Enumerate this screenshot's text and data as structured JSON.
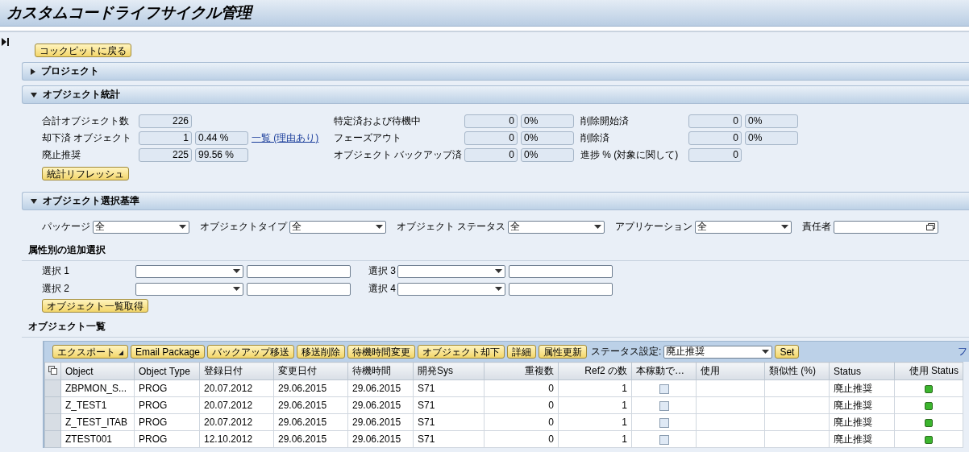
{
  "title": "カスタムコードライフサイクル管理",
  "back_button": "コックピットに戻る",
  "project_panel": {
    "title": "プロジェクト",
    "expanded": false
  },
  "stats_panel": {
    "title": "オブジェクト統計",
    "expanded": true,
    "columns": [
      [
        {
          "label": "合計オブジェクト数",
          "value": "226"
        },
        {
          "label": "却下済 オブジェクト",
          "value": "1",
          "percent": "0.44 %",
          "link": "一覧 (理由あり)"
        },
        {
          "label": "廃止推奨",
          "value": "225",
          "percent": "99.56 %"
        }
      ],
      [
        {
          "label": "特定済および待機中",
          "value": "0",
          "percent": "0%"
        },
        {
          "label": "フェーズアウト",
          "value": "0",
          "percent": "0%"
        },
        {
          "label": "オブジェクト バックアップ済",
          "value": "0",
          "percent": "0%"
        }
      ],
      [
        {
          "label": "削除開始済",
          "value": "0",
          "percent": "0%"
        },
        {
          "label": "削除済",
          "value": "0",
          "percent": "0%"
        },
        {
          "label": "進捗 % (対象に関して)",
          "value": "0"
        }
      ]
    ],
    "refresh_button": "統計リフレッシュ"
  },
  "criteria_panel": {
    "title": "オブジェクト選択基準",
    "expanded": true,
    "filters": [
      {
        "label": "パッケージ",
        "value": "全",
        "kind": "dropdown"
      },
      {
        "label": "オブジェクトタイプ",
        "value": "全",
        "kind": "dropdown"
      },
      {
        "label": "オブジェクト ステータス",
        "value": "全",
        "kind": "dropdown"
      },
      {
        "label": "アプリケーション",
        "value": "全",
        "kind": "dropdown"
      },
      {
        "label": "責任者",
        "kind": "picker"
      }
    ],
    "extra_title": "属性別の追加選択",
    "extra": [
      {
        "label": "選択 1"
      },
      {
        "label": "選択 3"
      },
      {
        "label": "選択 2"
      },
      {
        "label": "選択 4"
      }
    ],
    "fetch_button": "オブジェクト一覧取得"
  },
  "list_title": "オブジェクト一覧",
  "toolbar": {
    "buttons": [
      {
        "label": "エクスポート",
        "kind": "menu"
      },
      {
        "label": "Email Package",
        "kind": "plain"
      },
      {
        "label": "バックアップ移送",
        "kind": "plain"
      },
      {
        "label": "移送削除",
        "kind": "plain"
      },
      {
        "label": "待機時間変更",
        "kind": "plain"
      },
      {
        "label": "オブジェクト却下",
        "kind": "plain"
      },
      {
        "label": "詳細",
        "kind": "plain"
      },
      {
        "label": "属性更新",
        "kind": "plain"
      }
    ],
    "status_label": "ステータス設定:",
    "status_value": "廃止推奨",
    "set_button": "Set",
    "link": "フ"
  },
  "table": {
    "columns": [
      {
        "label": "Object",
        "kind": "text"
      },
      {
        "label": "Object Type",
        "kind": "text"
      },
      {
        "label": "登録日付",
        "kind": "text"
      },
      {
        "label": "変更日付",
        "kind": "text"
      },
      {
        "label": "待機時間",
        "kind": "text"
      },
      {
        "label": "開発Sys",
        "kind": "text"
      },
      {
        "label": "重複数",
        "kind": "number"
      },
      {
        "label": "Ref2 の数",
        "kind": "number"
      },
      {
        "label": "本稼動で…",
        "kind": "check"
      },
      {
        "label": "使用",
        "kind": "empty"
      },
      {
        "label": "類似性 (%)",
        "kind": "empty"
      },
      {
        "label": "Status",
        "kind": "status"
      },
      {
        "label": "使用 Status",
        "kind": "light"
      }
    ],
    "rows": [
      {
        "cells": [
          "ZBPMON_S...",
          "PROG",
          "20.07.2012",
          "29.06.2015",
          "29.06.2015",
          "S71",
          "0",
          "1"
        ],
        "checked": false,
        "status": "廃止推奨",
        "color": "#3cb52e"
      },
      {
        "cells": [
          "Z_TEST1",
          "PROG",
          "20.07.2012",
          "29.06.2015",
          "29.06.2015",
          "S71",
          "0",
          "1"
        ],
        "checked": false,
        "status": "廃止推奨",
        "color": "#3cb52e"
      },
      {
        "cells": [
          "Z_TEST_ITAB",
          "PROG",
          "20.07.2012",
          "29.06.2015",
          "29.06.2015",
          "S71",
          "0",
          "1"
        ],
        "checked": false,
        "status": "廃止推奨",
        "color": "#3cb52e"
      },
      {
        "cells": [
          "ZTEST001",
          "PROG",
          "12.10.2012",
          "29.06.2015",
          "29.06.2015",
          "S71",
          "0",
          "1"
        ],
        "checked": false,
        "status": "廃止推奨",
        "color": "#3cb52e"
      }
    ]
  }
}
